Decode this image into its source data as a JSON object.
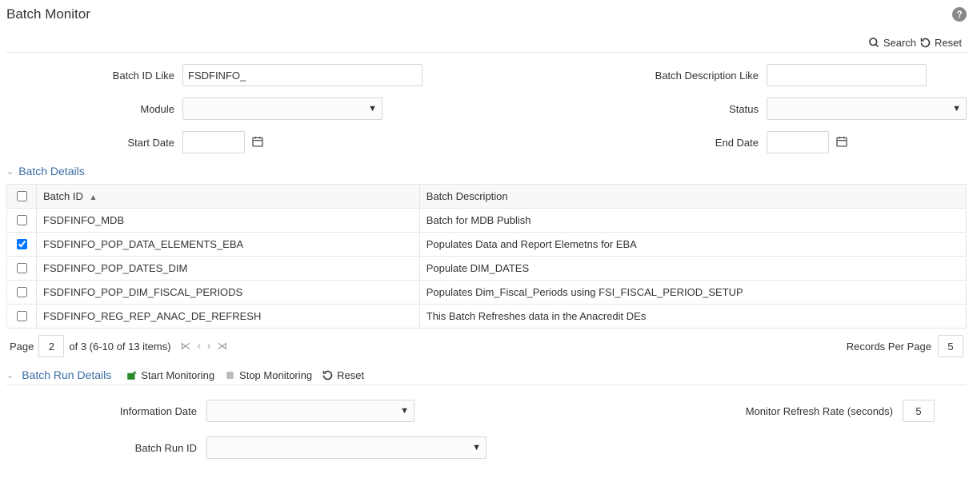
{
  "header": {
    "title": "Batch Monitor",
    "help_tooltip": "?"
  },
  "toolbar": {
    "search_label": "Search",
    "reset_label": "Reset"
  },
  "search": {
    "batch_id_label": "Batch ID Like",
    "batch_id_value": "FSDFINFO_",
    "batch_desc_label": "Batch Description Like",
    "batch_desc_value": "",
    "module_label": "Module",
    "module_value": "",
    "status_label": "Status",
    "status_value": "",
    "start_date_label": "Start Date",
    "start_date_value": "",
    "end_date_label": "End Date",
    "end_date_value": ""
  },
  "batch_details": {
    "title": "Batch Details",
    "columns": {
      "batch_id": "Batch ID",
      "batch_desc": "Batch Description"
    },
    "rows": [
      {
        "checked": false,
        "id": "FSDFINFO_MDB",
        "desc": "Batch for MDB Publish"
      },
      {
        "checked": true,
        "id": "FSDFINFO_POP_DATA_ELEMENTS_EBA",
        "desc": "Populates Data and Report Elemetns for EBA"
      },
      {
        "checked": false,
        "id": "FSDFINFO_POP_DATES_DIM",
        "desc": "Populate DIM_DATES"
      },
      {
        "checked": false,
        "id": "FSDFINFO_POP_DIM_FISCAL_PERIODS",
        "desc": "Populates Dim_Fiscal_Periods using FSI_FISCAL_PERIOD_SETUP"
      },
      {
        "checked": false,
        "id": "FSDFINFO_REG_REP_ANAC_DE_REFRESH",
        "desc": "This Batch Refreshes data in the Anacredit DEs"
      }
    ]
  },
  "pager": {
    "page_label": "Page",
    "page_value": "2",
    "page_suffix": "of 3 (6-10 of 13 items)",
    "records_label": "Records Per Page",
    "records_value": "5"
  },
  "batch_run": {
    "title": "Batch Run Details",
    "start_monitoring": "Start Monitoring",
    "stop_monitoring": "Stop Monitoring",
    "reset": "Reset",
    "info_date_label": "Information Date",
    "info_date_value": "",
    "refresh_label": "Monitor Refresh Rate (seconds)",
    "refresh_value": "5",
    "run_id_label": "Batch Run ID",
    "run_id_value": ""
  }
}
